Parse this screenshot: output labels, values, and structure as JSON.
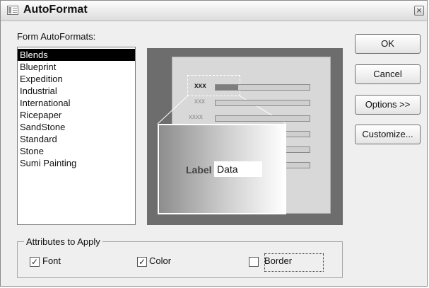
{
  "window": {
    "title": "AutoFormat",
    "icon": "form-icon",
    "close_glyph": "×"
  },
  "list": {
    "label": "Form AutoFormats:",
    "label_accelerator": "A",
    "items": [
      "Blends",
      "Blueprint",
      "Expedition",
      "Industrial",
      "International",
      "Ricepaper",
      "SandStone",
      "Standard",
      "Stone",
      "Sumi Painting"
    ],
    "selected": "Blends"
  },
  "preview": {
    "row_labels": [
      "xxx",
      "xxx",
      "xxxx"
    ],
    "card_label": "Label",
    "card_data": "Data"
  },
  "buttons": {
    "ok": "OK",
    "cancel": "Cancel",
    "options": "Options >>",
    "customize": "Customize..."
  },
  "attributes": {
    "title": "Attributes to Apply",
    "font": {
      "label": "Font",
      "checked": true
    },
    "color": {
      "label": "Color",
      "checked": true
    },
    "border": {
      "label": "Border",
      "checked": false
    }
  },
  "colors": {
    "selection": "#000000",
    "preview_bg": "#6d6d6d"
  }
}
